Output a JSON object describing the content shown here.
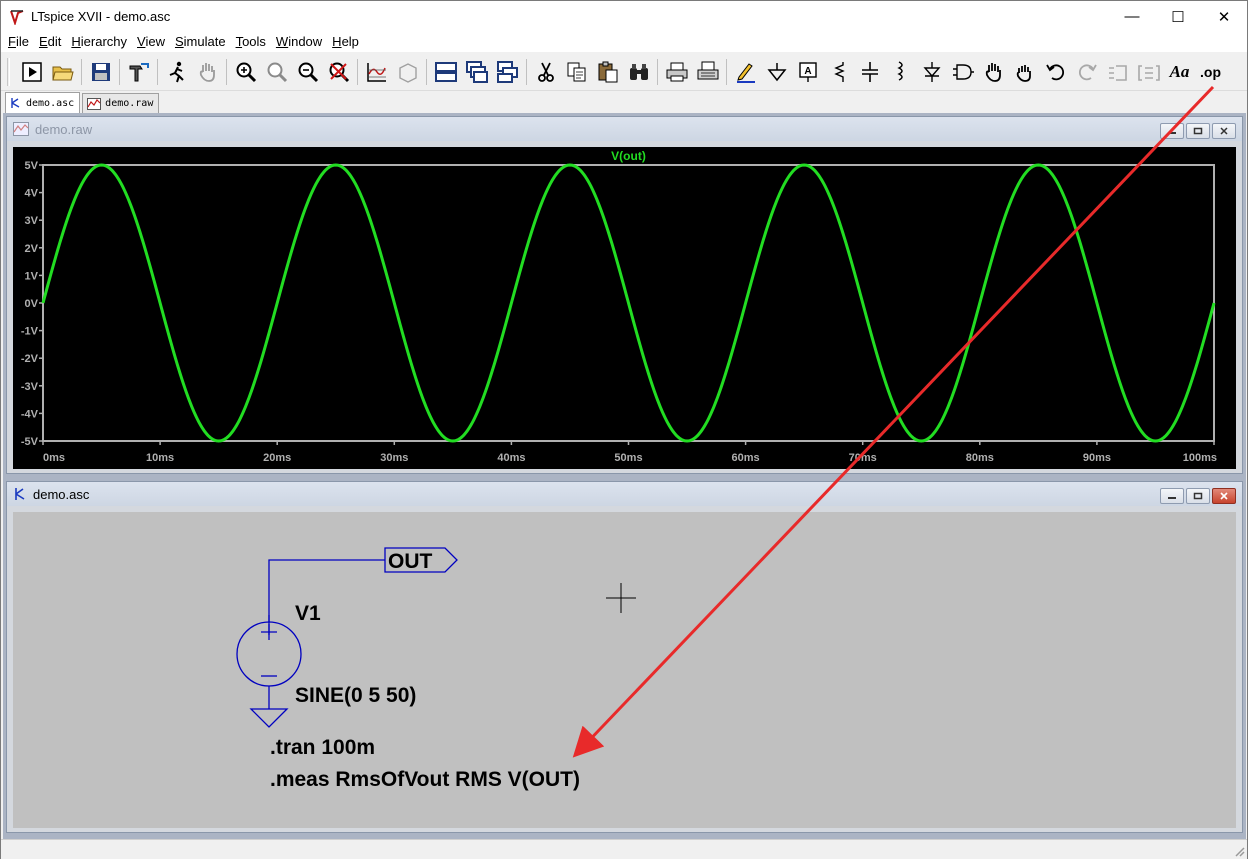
{
  "window": {
    "title": "LTspice XVII - demo.asc",
    "minimize_glyph": "—",
    "maximize_glyph": "☐",
    "close_glyph": "✕"
  },
  "menu": [
    {
      "label": "File",
      "key": "F"
    },
    {
      "label": "Edit",
      "key": "E"
    },
    {
      "label": "Hierarchy",
      "key": "H"
    },
    {
      "label": "View",
      "key": "V"
    },
    {
      "label": "Simulate",
      "key": "S"
    },
    {
      "label": "Tools",
      "key": "T"
    },
    {
      "label": "Window",
      "key": "W"
    },
    {
      "label": "Help",
      "key": "H"
    }
  ],
  "toolbar": {
    "op_label": ".op",
    "text_label": "Aa",
    "comment_a_label": "A"
  },
  "tabs": [
    {
      "label": "demo.asc",
      "icon": "schematic-icon"
    },
    {
      "label": "demo.raw",
      "icon": "waveform-icon"
    }
  ],
  "waveform_window": {
    "title": "demo.raw",
    "trace_color": "#22dd22",
    "frame_color": "#b0b0b0"
  },
  "chart_data": {
    "type": "line",
    "title": "V(out)",
    "series": [
      {
        "name": "V(out)",
        "function": "5*sin(2*pi*50*t)",
        "amplitude": 5,
        "frequency_hz": 50,
        "offset": 0
      }
    ],
    "xlim": [
      0,
      100
    ],
    "ylim": [
      -5,
      5
    ],
    "x_ticks": [
      0,
      10,
      20,
      30,
      40,
      50,
      60,
      70,
      80,
      90,
      100
    ],
    "x_tick_labels": [
      "0ms",
      "10ms",
      "20ms",
      "30ms",
      "40ms",
      "50ms",
      "60ms",
      "70ms",
      "80ms",
      "90ms",
      "100ms"
    ],
    "y_ticks": [
      5,
      4,
      3,
      2,
      1,
      0,
      -1,
      -2,
      -3,
      -4,
      -5
    ],
    "y_tick_labels": [
      "5V",
      "4V",
      "3V",
      "2V",
      "1V",
      "0V",
      "-1V",
      "-2V",
      "-3V",
      "-4V",
      "-5V"
    ],
    "grid": false
  },
  "schematic_window": {
    "title": "demo.asc",
    "net_label": "OUT",
    "source_name": "V1",
    "source_value": "SINE(0 5 50)",
    "directive_tran": ".tran 100m",
    "directive_meas": ".meas RmsOfVout RMS V(OUT)",
    "wire_color": "#0000c0",
    "text_color": "#000000"
  },
  "annotation": {
    "arrow_color": "#e82a2a"
  }
}
